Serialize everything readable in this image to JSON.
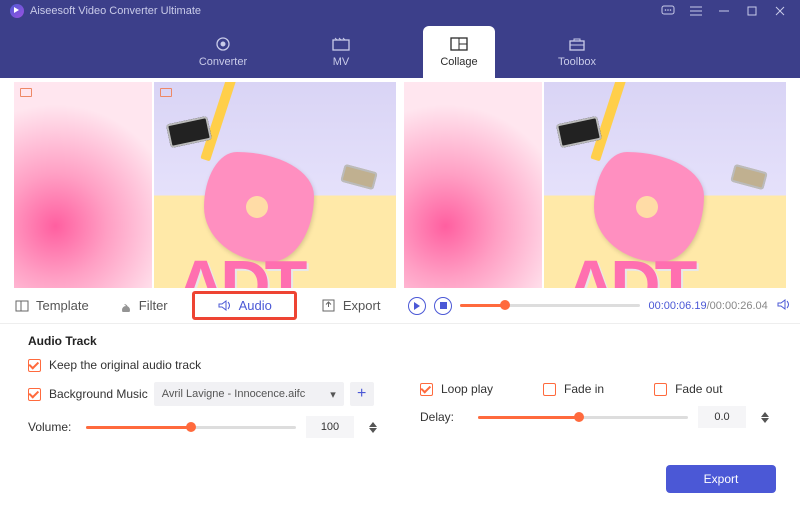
{
  "titlebar": {
    "app_title": "Aiseesoft Video Converter Ultimate"
  },
  "nav": {
    "tabs": [
      {
        "label": "Converter"
      },
      {
        "label": "MV"
      },
      {
        "label": "Collage",
        "active": true
      },
      {
        "label": "Toolbox"
      }
    ]
  },
  "subtabs": {
    "items": [
      {
        "label": "Template"
      },
      {
        "label": "Filter"
      },
      {
        "label": "Audio",
        "active": true
      },
      {
        "label": "Export"
      }
    ]
  },
  "player": {
    "current_time": "00:00:06.19",
    "total_time": "00:00:26.04",
    "separator": "/"
  },
  "audio": {
    "section_title": "Audio Track",
    "keep_original_label": "Keep the original audio track",
    "keep_original_checked": true,
    "background_music_label": "Background Music",
    "background_music_checked": true,
    "selected_track": "Avril Lavigne - Innocence.aifc",
    "volume_label": "Volume:",
    "volume_value": "100",
    "volume_pct": 50,
    "loop_label": "Loop play",
    "loop_checked": true,
    "fadein_label": "Fade in",
    "fadein_checked": false,
    "fadeout_label": "Fade out",
    "fadeout_checked": false,
    "delay_label": "Delay:",
    "delay_value": "0.0",
    "delay_pct": 48
  },
  "footer": {
    "export_label": "Export"
  },
  "colors": {
    "accent_blue": "#4b58d6",
    "accent_orange": "#ff6a3d",
    "header_bg": "#3c3f8a"
  }
}
